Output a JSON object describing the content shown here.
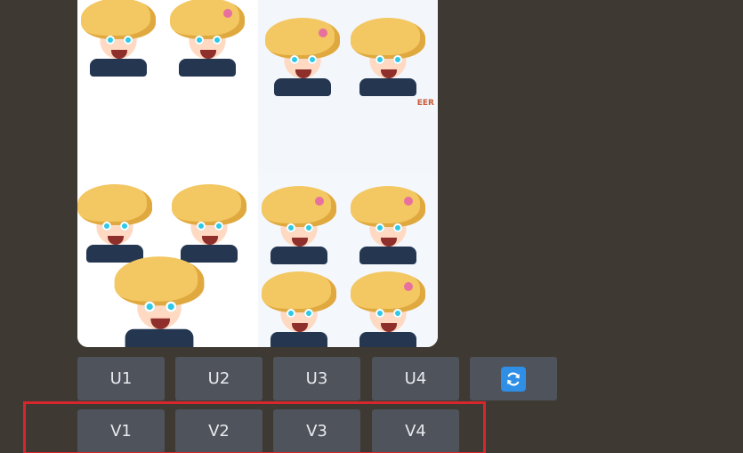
{
  "image": {
    "watermark": "EER",
    "colors": {
      "hair": "#f3c762",
      "eyes": "#2ec9e6",
      "armor": "#243650",
      "gem": "#e8709e"
    }
  },
  "upscale_buttons": [
    {
      "label": "U1"
    },
    {
      "label": "U2"
    },
    {
      "label": "U3"
    },
    {
      "label": "U4"
    }
  ],
  "reroll_button": {
    "icon": "refresh-icon"
  },
  "variation_buttons": [
    {
      "label": "V1"
    },
    {
      "label": "V2"
    },
    {
      "label": "V3"
    },
    {
      "label": "V4"
    }
  ],
  "highlight": {
    "color": "#d8262d"
  }
}
